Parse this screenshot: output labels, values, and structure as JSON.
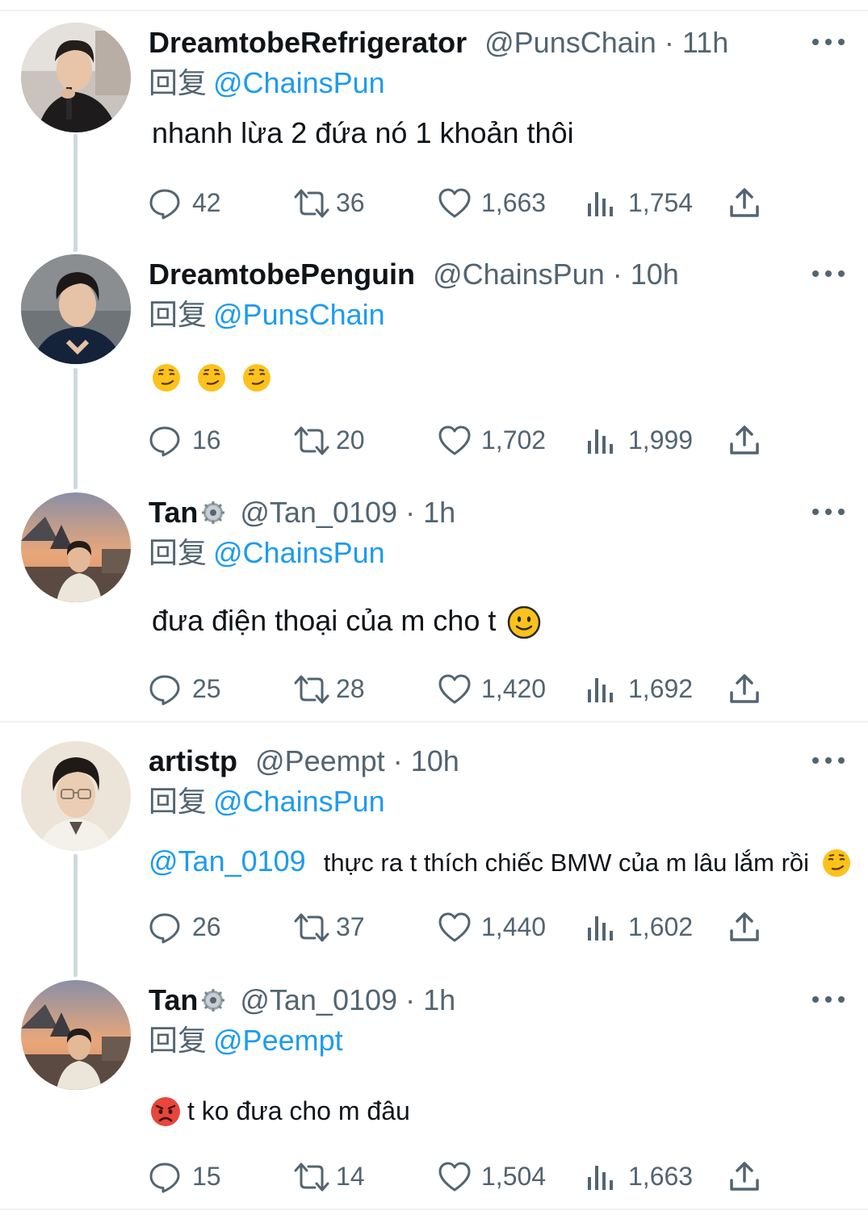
{
  "reply_prefix": "回复",
  "colors": {
    "link": "#1d9bf0",
    "secondary_text": "#536471",
    "thread_line": "#cfd9de"
  },
  "icons": {
    "more": "more-options-icon",
    "reply": "reply-bubble-icon",
    "retweet": "retweet-icon",
    "like": "heart-icon",
    "views": "views-bar-chart-icon",
    "share": "share-upload-icon"
  },
  "tweets": [
    {
      "name": "DreamtobeRefrigerator",
      "handle": "@PunsChain",
      "time": "11h",
      "reply_to": "@ChainsPun",
      "text": "nhanh lừa 2 đứa nó 1 khoản thôi",
      "stats": {
        "replies": "42",
        "retweets": "36",
        "likes": "1,663",
        "views": "1,754"
      }
    },
    {
      "name": "DreamtobePenguin",
      "handle": "@ChainsPun",
      "time": "10h",
      "reply_to": "@PunsChain",
      "emojis": [
        "smirking-face",
        "smirking-face",
        "smirking-face"
      ],
      "stats": {
        "replies": "16",
        "retweets": "20",
        "likes": "1,702",
        "views": "1,999"
      }
    },
    {
      "name": "Tan",
      "handle": "@Tan_0109",
      "time": "1h",
      "reply_to": "@ChainsPun",
      "text": "đưa điện thoại của m cho t",
      "emojis": [
        "slightly-smiling-face"
      ],
      "stats": {
        "replies": "25",
        "retweets": "28",
        "likes": "1,420",
        "views": "1,692"
      }
    },
    {
      "name": "artistp",
      "handle": "@Peempt",
      "time": "10h",
      "reply_to": "@ChainsPun",
      "mention": "@Tan_0109",
      "text": "thực ra t thích chiếc BMW của m lâu lắm rồi",
      "emojis": [
        "smirking-face"
      ],
      "stats": {
        "replies": "26",
        "retweets": "37",
        "likes": "1,440",
        "views": "1,602"
      }
    },
    {
      "name": "Tan",
      "handle": "@Tan_0109",
      "time": "1h",
      "reply_to": "@Peempt",
      "text": "t ko đưa cho m đâu",
      "emojis": [
        "pouting-face"
      ],
      "stats": {
        "replies": "15",
        "retweets": "14",
        "likes": "1,504",
        "views": "1,663"
      }
    }
  ]
}
